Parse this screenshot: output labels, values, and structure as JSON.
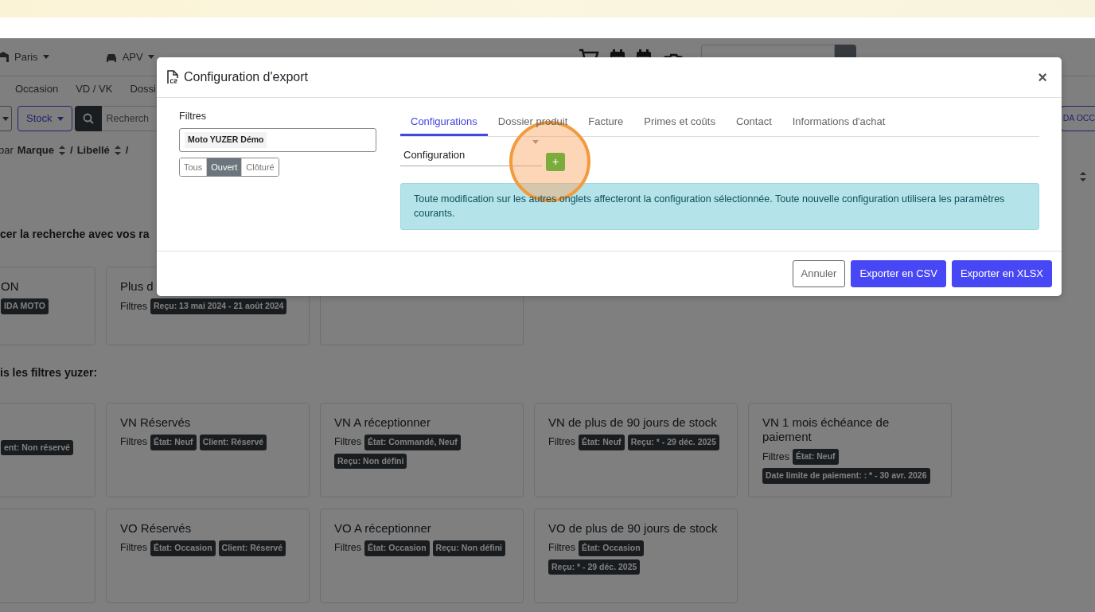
{
  "page": {
    "places": [
      {
        "label": "Paris"
      },
      {
        "label": "APV"
      }
    ],
    "menu": [
      "Occasion",
      "VD / VK",
      "Dossi"
    ],
    "stock_dropdown": "Stock",
    "query": {
      "placeholder": "Recherch"
    },
    "right_button": "DA OCC",
    "sort": {
      "prefix": "par",
      "fields": [
        {
          "label": "Marque",
          "separator": "/"
        },
        {
          "label": "Libellé",
          "separator": "/"
        }
      ]
    },
    "sections": [
      {
        "heading": "cer la recherche avec vos ra",
        "cards": [
          {
            "kind": "filter",
            "title": "ON",
            "badges": [
              "IDA MOTO"
            ]
          },
          {
            "kind": "filter",
            "title": "Plus d",
            "filters_label": "Filtres",
            "badges": [
              "Reçu: 13 mai 2024 - 21 août 2024"
            ]
          },
          {
            "kind": "empty"
          }
        ]
      },
      {
        "heading": "is les filtres yuzer:",
        "cards": [
          {
            "kind": "filter",
            "badges": [
              "ent: Non réservé"
            ]
          },
          {
            "title": "VN Réservés",
            "filters_label": "Filtres",
            "badges": [
              "État: Neuf",
              "Client: Réservé"
            ]
          },
          {
            "title": "VN A réceptionner",
            "filters_label": "Filtres",
            "badges": [
              "État: Commandé, Neuf",
              "Reçu: Non défini"
            ]
          },
          {
            "title": "VN de plus de 90 jours de stock",
            "filters_label": "Filtres",
            "badges": [
              "État: Neuf",
              "Reçu: * - 29 déc. 2025"
            ]
          },
          {
            "title": "VN 1 mois échéance de paiement",
            "filters_label": "Filtres",
            "badges": [
              "État: Neuf",
              "Date limite de paiement: : * - 30 avr. 2026"
            ]
          },
          {
            "kind": "empty"
          },
          {
            "title": "VO Réservés",
            "filters_label": "Filtres",
            "badges": [
              "État: Occasion",
              "Client: Réservé"
            ]
          },
          {
            "title": "VO A réceptionner",
            "filters_label": "Filtres",
            "badges": [
              "État: Occasion",
              "Reçu: Non défini"
            ]
          },
          {
            "title": "VO de plus de 90 jours de stock",
            "filters_label": "Filtres",
            "badges": [
              "État: Occasion",
              "Reçu: * - 29 déc. 2025"
            ]
          }
        ]
      }
    ]
  },
  "modal": {
    "title": "Configuration d'export",
    "close": "×",
    "filters": {
      "label": "Filtres",
      "tags": [
        "Moto YUZER Démo"
      ],
      "states": [
        {
          "label": "Tous",
          "selected": false
        },
        {
          "label": "Ouvert",
          "selected": true
        },
        {
          "label": "Clôturé",
          "selected": false
        }
      ]
    },
    "tabs": [
      {
        "label": "Configurations",
        "selected": true
      },
      {
        "label": "Dossier produit",
        "selected": false
      },
      {
        "label": "Facture",
        "selected": false
      },
      {
        "label": "Primes et coûts",
        "selected": false
      },
      {
        "label": "Contact",
        "selected": false
      },
      {
        "label": "Informations d'achat",
        "selected": false
      }
    ],
    "configuration": {
      "placeholder": "Configuration",
      "add": "+"
    },
    "info": "Toute modification sur les autres onglets affecteront la configuration sélectionnée. Toute nouvelle configuration utilisera les paramètres courants.",
    "buttons": [
      {
        "label": "Annuler",
        "kind": "secondary"
      },
      {
        "label": "Exporter en CSV",
        "kind": "primary"
      },
      {
        "label": "Exporter en XLSX",
        "kind": "primary"
      }
    ]
  }
}
